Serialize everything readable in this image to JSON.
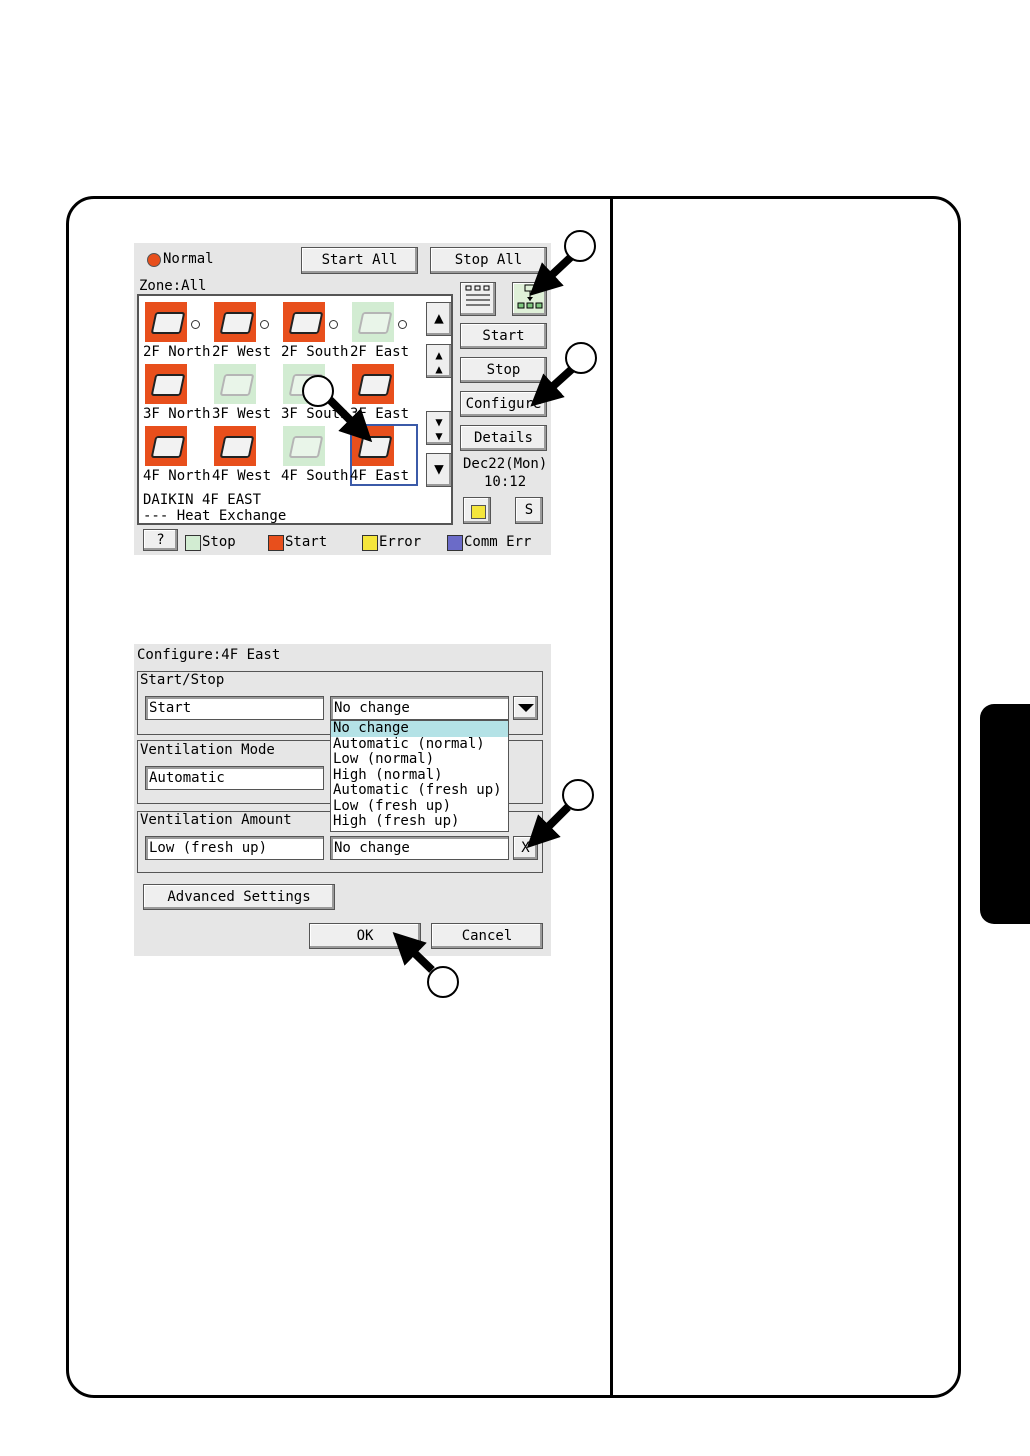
{
  "screen1": {
    "status_label": "Normal",
    "start_all_label": "Start All",
    "stop_all_label": "Stop All",
    "zone_label": "Zone:All",
    "units": [
      {
        "label": "2F North",
        "state": "start",
        "icon": "ceiling-unit-icon"
      },
      {
        "label": "2F West",
        "state": "start",
        "icon": "cassette-unit-icon"
      },
      {
        "label": "2F South",
        "state": "start",
        "icon": "floor-standing-unit-icon"
      },
      {
        "label": "2F East",
        "state": "stop",
        "icon": "wall-unit-icon"
      },
      {
        "label": "3F North",
        "state": "start",
        "icon": "ceiling-suspended-unit-icon"
      },
      {
        "label": "3F West",
        "state": "stop",
        "icon": "ventilator-unit-icon"
      },
      {
        "label": "3F South",
        "state": "stop",
        "icon": "wall-unit-icon"
      },
      {
        "label": "3F East",
        "state": "start",
        "icon": "cassette-unit-icon"
      },
      {
        "label": "4F North",
        "state": "start",
        "icon": "cassette-unit-icon"
      },
      {
        "label": "4F West",
        "state": "start",
        "icon": "cassette-unit-icon"
      },
      {
        "label": "4F South",
        "state": "stop",
        "icon": "cassette-unit-icon"
      },
      {
        "label": "4F East",
        "state": "start",
        "icon": "heat-exchanger-icon"
      }
    ],
    "info_line1": "DAIKIN 4F EAST",
    "info_line2": "---   Heat Exchange",
    "start_label": "Start",
    "stop_label": "Stop",
    "configure_label": "Configure",
    "details_label": "Details",
    "date": "Dec22(Mon)",
    "time": "10:12",
    "s_label": "S",
    "help_label": "?",
    "legend": [
      {
        "label": "Stop",
        "color": "#d2ecd2"
      },
      {
        "label": "Start",
        "color": "#e84f1c"
      },
      {
        "label": "Error",
        "color": "#f5e63c"
      },
      {
        "label": "Comm Err",
        "color": "#6b6bc8"
      }
    ]
  },
  "screen2": {
    "title": "Configure:4F East",
    "startstop_heading": "Start/Stop",
    "startstop_current": "Start",
    "startstop_select": "No change",
    "ventmode_heading": "Ventilation Mode",
    "ventmode_current": "Automatic",
    "ventamount_heading": "Ventilation Amount",
    "ventamount_current": "Low (fresh up)",
    "ventamount_select": "No change",
    "clear_label": "X",
    "dropdown_options": [
      "No change",
      "Automatic (normal)",
      "Low (normal)",
      "High (normal)",
      "Automatic (fresh up)",
      "Low (fresh up)",
      "High (fresh up)"
    ],
    "advanced_label": "Advanced Settings",
    "ok_label": "OK",
    "cancel_label": "Cancel"
  }
}
